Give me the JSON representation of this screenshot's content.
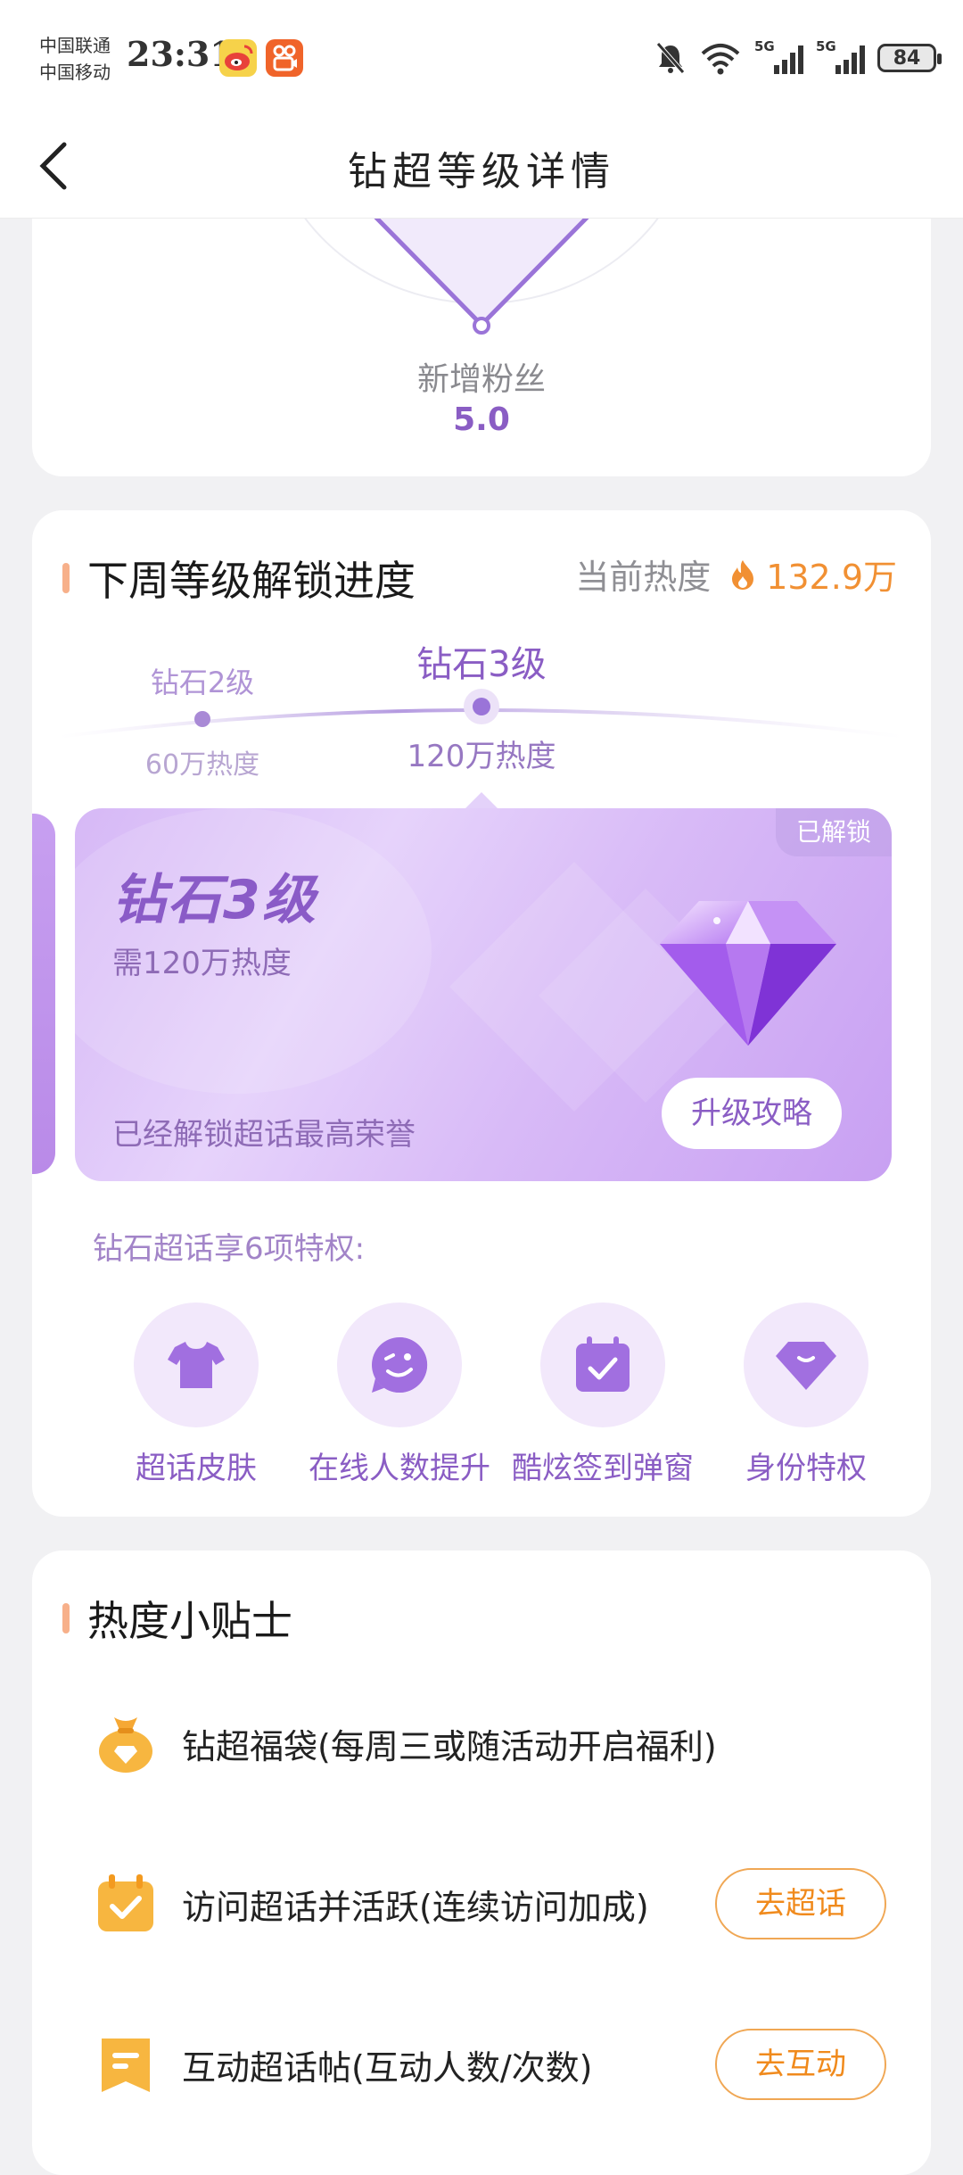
{
  "status_bar": {
    "carrier1": "中国联通",
    "carrier2": "中国移动",
    "time": "23:31",
    "battery": "84",
    "network1": "5G",
    "network2": "5G"
  },
  "nav": {
    "title": "钻超等级详情"
  },
  "stat": {
    "label": "新增粉丝",
    "value": "5.0"
  },
  "unlock_section": {
    "title": "下周等级解锁进度",
    "heat_label": "当前热度",
    "heat_value": "132.9万",
    "levels": [
      {
        "name": "钻石2级",
        "heat": "60万热度"
      },
      {
        "name": "钻石3级",
        "heat": "120万热度"
      }
    ],
    "card": {
      "badge": "已解锁",
      "title": "钻石3级",
      "requirement": "需120万热度",
      "description": "已经解锁超话最高荣誉",
      "button": "升级攻略"
    },
    "privilege_title": "钻石超话享6项特权:",
    "privileges": [
      {
        "label": "超话皮肤",
        "icon": "tshirt-icon"
      },
      {
        "label": "在线人数提升",
        "icon": "smile-icon"
      },
      {
        "label": "酷炫签到弹窗",
        "icon": "calendar-check-icon"
      },
      {
        "label": "身份特权",
        "icon": "diamond-icon"
      }
    ]
  },
  "tips_section": {
    "title": "热度小贴士",
    "items": [
      {
        "text": "钻超福袋(每周三或随活动开启福利)",
        "button": ""
      },
      {
        "text": "访问超话并活跃(连续访问加成)",
        "button": "去超话"
      },
      {
        "text": "互动超话帖(互动人数/次数)",
        "button": "去互动"
      }
    ]
  },
  "colors": {
    "accent_purple": "#8a5dc4",
    "accent_orange": "#f08a1c",
    "card_gradient": "#d6b8f6"
  }
}
